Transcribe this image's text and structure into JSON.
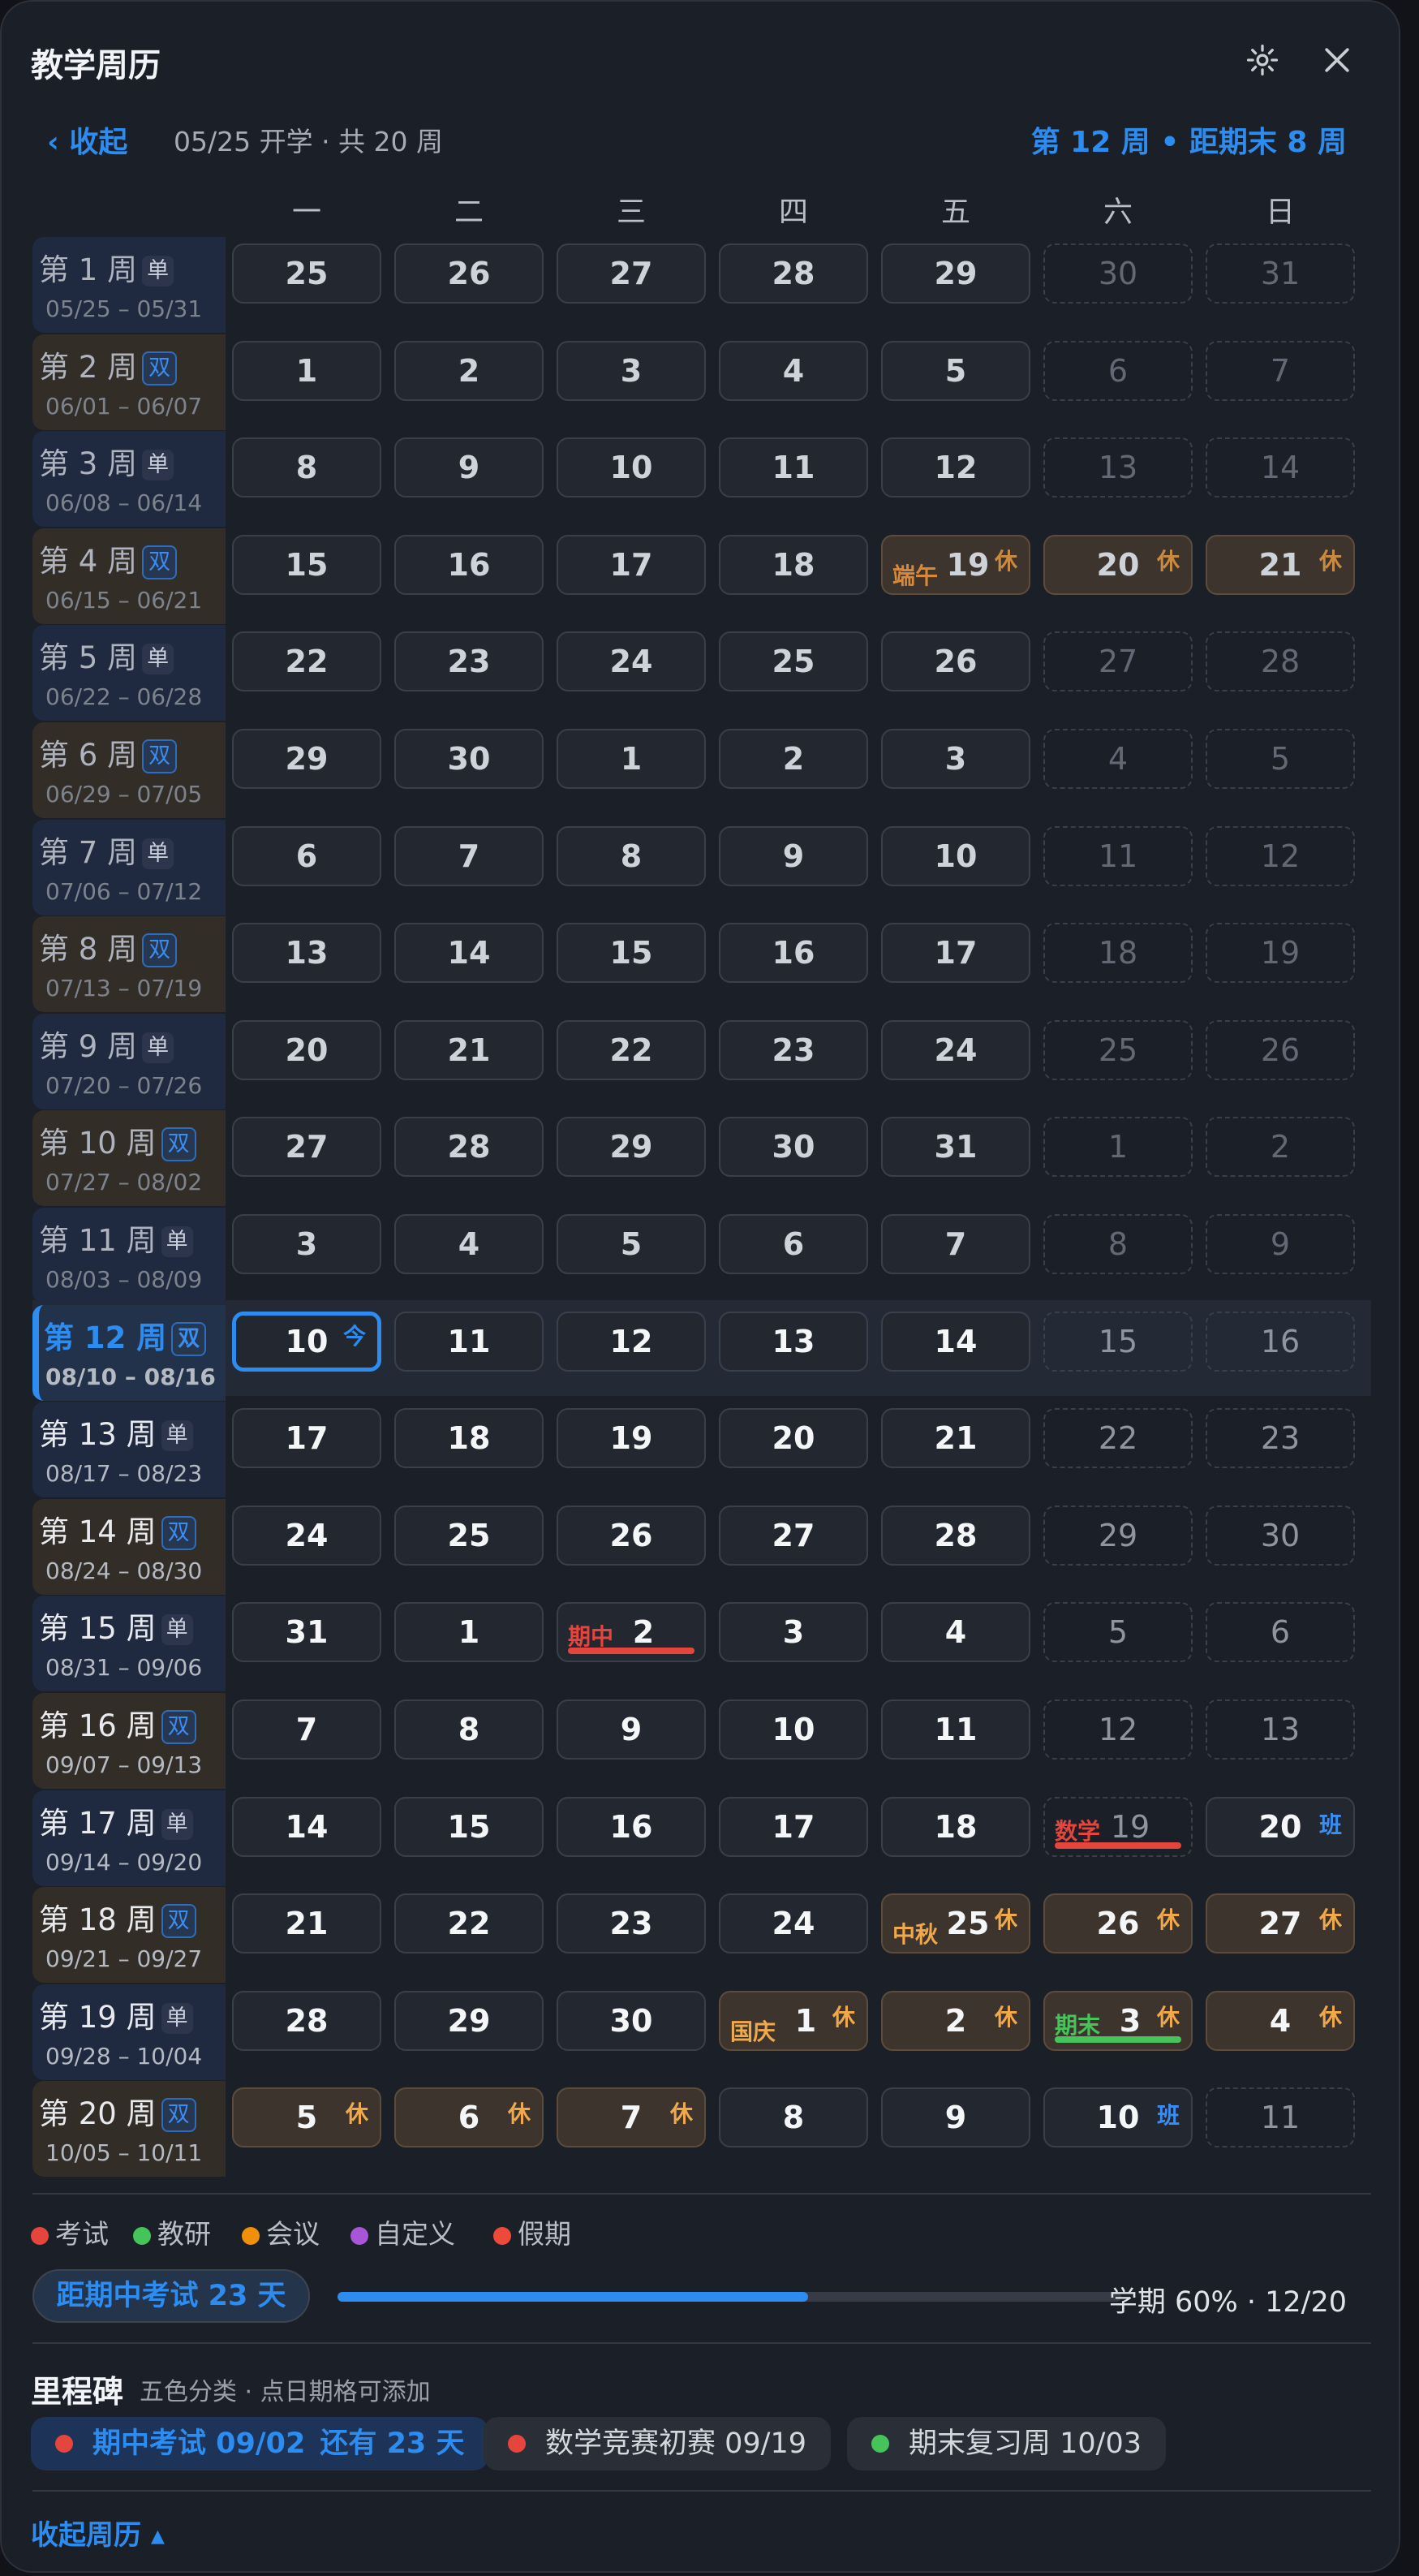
{
  "header": {
    "title": "教学周历",
    "collapse_label": "‹ 收起",
    "subtitle": "05/25 开学 · 共 20 周",
    "progress": "第 12 周 • 距期末 8 周"
  },
  "day_headers": [
    "一",
    "二",
    "三",
    "四",
    "五",
    "六",
    "日"
  ],
  "current_week": 12,
  "weeks": [
    {
      "label": "第 1 周",
      "tag": "单",
      "range": "05/25 – 05/31",
      "days": [
        "25",
        "26",
        "27",
        "28",
        "29",
        "30",
        "31"
      ]
    },
    {
      "label": "第 2 周",
      "tag": "双",
      "range": "06/01 – 06/07",
      "days": [
        "1",
        "2",
        "3",
        "4",
        "5",
        "6",
        "7"
      ]
    },
    {
      "label": "第 3 周",
      "tag": "单",
      "range": "06/08 – 06/14",
      "days": [
        "8",
        "9",
        "10",
        "11",
        "12",
        "13",
        "14"
      ]
    },
    {
      "label": "第 4 周",
      "tag": "双",
      "range": "06/15 – 06/21",
      "days": [
        "15",
        "16",
        "17",
        "18",
        "19",
        "20",
        "21"
      ]
    },
    {
      "label": "第 5 周",
      "tag": "单",
      "range": "06/22 – 06/28",
      "days": [
        "22",
        "23",
        "24",
        "25",
        "26",
        "27",
        "28"
      ]
    },
    {
      "label": "第 6 周",
      "tag": "双",
      "range": "06/29 – 07/05",
      "days": [
        "29",
        "30",
        "1",
        "2",
        "3",
        "4",
        "5"
      ]
    },
    {
      "label": "第 7 周",
      "tag": "单",
      "range": "07/06 – 07/12",
      "days": [
        "6",
        "7",
        "8",
        "9",
        "10",
        "11",
        "12"
      ]
    },
    {
      "label": "第 8 周",
      "tag": "双",
      "range": "07/13 – 07/19",
      "days": [
        "13",
        "14",
        "15",
        "16",
        "17",
        "18",
        "19"
      ]
    },
    {
      "label": "第 9 周",
      "tag": "单",
      "range": "07/20 – 07/26",
      "days": [
        "20",
        "21",
        "22",
        "23",
        "24",
        "25",
        "26"
      ]
    },
    {
      "label": "第 10 周",
      "tag": "双",
      "range": "07/27 – 08/02",
      "days": [
        "27",
        "28",
        "29",
        "30",
        "31",
        "1",
        "2"
      ]
    },
    {
      "label": "第 11 周",
      "tag": "单",
      "range": "08/03 – 08/09",
      "days": [
        "3",
        "4",
        "5",
        "6",
        "7",
        "8",
        "9"
      ]
    },
    {
      "label": "第 12 周",
      "tag": "双",
      "range": "08/10 – 08/16",
      "days": [
        "10",
        "11",
        "12",
        "13",
        "14",
        "15",
        "16"
      ]
    },
    {
      "label": "第 13 周",
      "tag": "单",
      "range": "08/17 – 08/23",
      "days": [
        "17",
        "18",
        "19",
        "20",
        "21",
        "22",
        "23"
      ]
    },
    {
      "label": "第 14 周",
      "tag": "双",
      "range": "08/24 – 08/30",
      "days": [
        "24",
        "25",
        "26",
        "27",
        "28",
        "29",
        "30"
      ]
    },
    {
      "label": "第 15 周",
      "tag": "单",
      "range": "08/31 – 09/06",
      "days": [
        "31",
        "1",
        "2",
        "3",
        "4",
        "5",
        "6"
      ]
    },
    {
      "label": "第 16 周",
      "tag": "双",
      "range": "09/07 – 09/13",
      "days": [
        "7",
        "8",
        "9",
        "10",
        "11",
        "12",
        "13"
      ]
    },
    {
      "label": "第 17 周",
      "tag": "单",
      "range": "09/14 – 09/20",
      "days": [
        "14",
        "15",
        "16",
        "17",
        "18",
        "19",
        "20"
      ]
    },
    {
      "label": "第 18 周",
      "tag": "双",
      "range": "09/21 – 09/27",
      "days": [
        "21",
        "22",
        "23",
        "24",
        "25",
        "26",
        "27"
      ]
    },
    {
      "label": "第 19 周",
      "tag": "单",
      "range": "09/28 – 10/04",
      "days": [
        "28",
        "29",
        "30",
        "1",
        "2",
        "3",
        "4"
      ]
    },
    {
      "label": "第 20 周",
      "tag": "双",
      "range": "10/05 – 10/11",
      "days": [
        "5",
        "6",
        "7",
        "8",
        "9",
        "10",
        "11"
      ]
    }
  ],
  "special_cells": [
    {
      "w": 4,
      "d": 5,
      "hol": true,
      "rest": "休",
      "event": "端午",
      "event_color": "#d9873a"
    },
    {
      "w": 4,
      "d": 6,
      "hol": true,
      "rest": "休"
    },
    {
      "w": 4,
      "d": 7,
      "hol": true,
      "rest": "休"
    },
    {
      "w": 12,
      "d": 1,
      "today": true,
      "badge": "今"
    },
    {
      "w": 15,
      "d": 3,
      "event": "期中",
      "event_color": "#e5453d",
      "bar": "#e5453d"
    },
    {
      "w": 17,
      "d": 6,
      "event": "数学",
      "event_color": "#e5453d",
      "bar": "#e5453d"
    },
    {
      "w": 17,
      "d": 7,
      "workday": true,
      "ban": "班"
    },
    {
      "w": 18,
      "d": 5,
      "hol": true,
      "rest": "休",
      "event": "中秋",
      "event_color": "#f0a94a"
    },
    {
      "w": 18,
      "d": 6,
      "hol": true,
      "rest": "休"
    },
    {
      "w": 18,
      "d": 7,
      "hol": true,
      "rest": "休"
    },
    {
      "w": 19,
      "d": 4,
      "hol": true,
      "rest": "休",
      "event": "国庆",
      "event_color": "#f0a94a"
    },
    {
      "w": 19,
      "d": 5,
      "hol": true,
      "rest": "休"
    },
    {
      "w": 19,
      "d": 6,
      "hol": true,
      "rest": "休",
      "event": "期末",
      "event_color": "#45c45a",
      "bar": "#45c45a"
    },
    {
      "w": 19,
      "d": 7,
      "hol": true,
      "rest": "休"
    },
    {
      "w": 20,
      "d": 1,
      "hol": true,
      "rest": "休"
    },
    {
      "w": 20,
      "d": 2,
      "hol": true,
      "rest": "休"
    },
    {
      "w": 20,
      "d": 3,
      "hol": true,
      "rest": "休"
    },
    {
      "w": 20,
      "d": 6,
      "workday": true,
      "ban": "班"
    }
  ],
  "legend": [
    {
      "label": "考试",
      "color": "#e5453d"
    },
    {
      "label": "教研",
      "color": "#45c45a"
    },
    {
      "label": "会议",
      "color": "#f0900a"
    },
    {
      "label": "自定义",
      "color": "#a855d8"
    },
    {
      "label": "假期",
      "color": "#ee4a3a"
    }
  ],
  "countdown": {
    "label": "距期中考试 23 天",
    "fill_fraction": 0.6,
    "text": "学期 60% · 12/20"
  },
  "milestones": {
    "title": "里程碑",
    "subtitle": "五色分类 · 点日期格可添加",
    "items": [
      {
        "label": "期中考试 09/02",
        "days": "还有 23 天",
        "color": "#e5453d"
      },
      {
        "label": "数学竞赛初赛 09/19",
        "color": "#e5453d"
      },
      {
        "label": "期末复习周 10/03",
        "color": "#45c45a"
      }
    ]
  },
  "footer": {
    "collapse_label": "收起周历 ▴"
  },
  "colors": {
    "accent": "#2d8cf0",
    "holiday": "#f0a94a"
  }
}
